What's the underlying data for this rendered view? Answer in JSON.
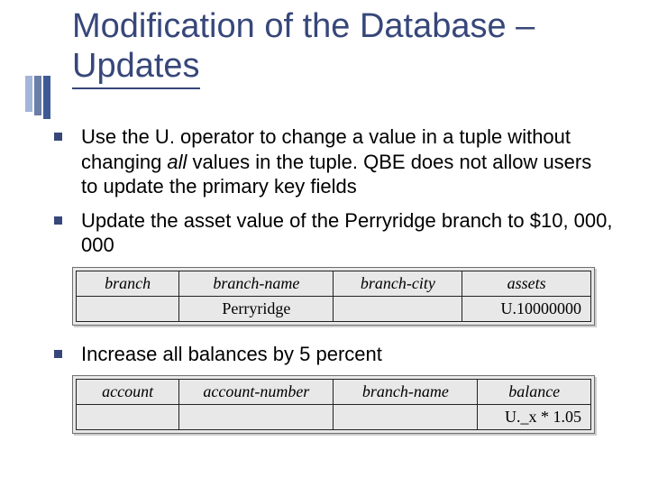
{
  "title_line1": "Modification of the Database –",
  "title_line2": "Updates",
  "bullets": {
    "b1_pre": "Use the U. operator to change a value in a tuple without changing ",
    "b1_italic": "all",
    "b1_post": "  values in the tuple. QBE does not allow users to update the primary key fields",
    "b2": "Update the asset value of the Perryridge branch to $10, 000, 000",
    "b3": "Increase all balances by 5 percent"
  },
  "table1": {
    "headers": [
      "branch",
      "branch-name",
      "branch-city",
      "assets"
    ],
    "row": [
      "",
      "Perryridge",
      "",
      "U.10000000"
    ]
  },
  "table2": {
    "headers": [
      "account",
      "account-number",
      "branch-name",
      "balance"
    ],
    "row": [
      "",
      "",
      "",
      "U._x * 1.05"
    ]
  }
}
